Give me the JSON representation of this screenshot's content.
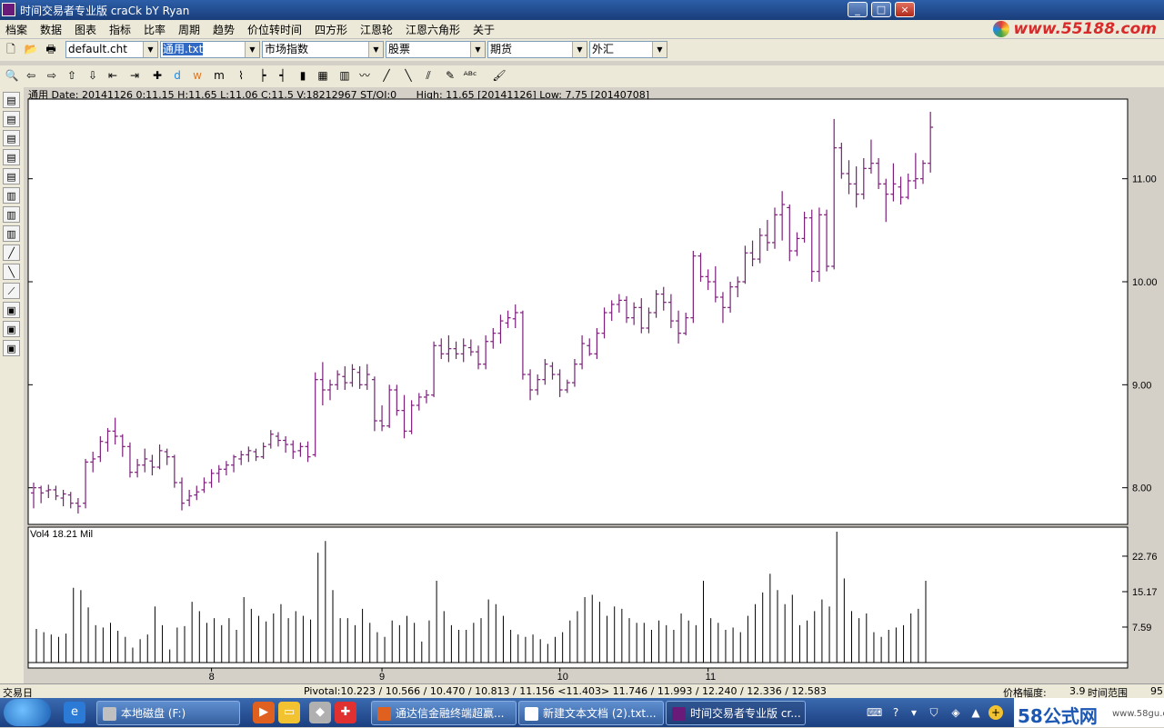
{
  "window": {
    "title": "时间交易者专业版 craCk bY Ryan",
    "buttons": [
      "_",
      "□",
      "×"
    ],
    "logo_text": "www.55188.com"
  },
  "menu": [
    "档案",
    "数据",
    "图表",
    "指标",
    "比率",
    "周期",
    "趋势",
    "价位转时间",
    "四方形",
    "江恩轮",
    "江恩六角形",
    "关于"
  ],
  "toolbar1": {
    "combos": [
      {
        "name": "chart-file",
        "value": "default.cht"
      },
      {
        "name": "data-file",
        "value": "通用.txt"
      },
      {
        "name": "market-index",
        "value": "市场指数"
      },
      {
        "name": "stocks",
        "value": "股票"
      },
      {
        "name": "futures",
        "value": "期货"
      },
      {
        "name": "forex",
        "value": "外汇"
      }
    ]
  },
  "toolbar2": {
    "icons": [
      "zoom-icon",
      "arrow-left-icon",
      "arrow-right-icon",
      "arrow-up-icon",
      "arrow-down-icon",
      "bar-left-icon",
      "bar-right-icon",
      "crosshair-icon",
      "daily-icon",
      "weekly-icon",
      "monthly-icon",
      "line-chart-icon",
      "ohlc-icon",
      "hlc-icon",
      "volume-icon",
      "calendar-icon",
      "bar-chart-icon",
      "swing-icon",
      "trend-icon",
      "line-tool-icon",
      "parallel-icon",
      "gann-fan-icon",
      "abc-icon",
      "brush-icon"
    ],
    "glyphs": [
      "🔍",
      "⇦",
      "⇨",
      "⇧",
      "⇩",
      "⇤",
      "⇥",
      "✚",
      "d",
      "w",
      "m",
      "⌇",
      "┝",
      "┥",
      "▮",
      "▦",
      "▥",
      "〰",
      "╱",
      "╲",
      "⫽",
      "✎",
      "ᴬᴮᶜ",
      "🖌"
    ]
  },
  "left_tools": [
    "▤",
    "▤",
    "▤",
    "▤",
    "▤",
    "▥",
    "▥",
    "▥",
    "╱",
    "╲",
    "⟋",
    "▣",
    "▣",
    "▣"
  ],
  "chart": {
    "info": "通用  Date: 20141126 0:11.15  H:11.65  L:11.06  C:11.5  V:18212967 ST/OI:0",
    "high_low": "High: 11.65 [20141126]  Low: 7.75 [20140708]"
  },
  "chart_data": {
    "type": "ohlc",
    "price_axis_ticks": [
      "11.00",
      "10.00",
      "9.00",
      "8.00"
    ],
    "price_ylim": [
      7.75,
      11.65
    ],
    "x_month_labels": [
      "8",
      "9",
      "10",
      "11"
    ],
    "volume_label": "Vol4  18.21 Mil",
    "volume_ticks": [
      "22.76",
      "15.17",
      "7.59"
    ],
    "volume_ylim": [
      0,
      28
    ],
    "ohlc": [
      [
        7.95,
        8.05,
        7.8,
        8.0
      ],
      [
        8.0,
        8.02,
        7.85,
        7.95
      ],
      [
        7.97,
        8.03,
        7.9,
        7.98
      ],
      [
        7.98,
        8.02,
        7.88,
        7.92
      ],
      [
        7.9,
        7.98,
        7.82,
        7.94
      ],
      [
        7.93,
        7.96,
        7.8,
        7.85
      ],
      [
        7.85,
        7.9,
        7.75,
        7.82
      ],
      [
        7.85,
        8.28,
        7.8,
        8.25
      ],
      [
        8.25,
        8.35,
        8.15,
        8.28
      ],
      [
        8.3,
        8.5,
        8.25,
        8.45
      ],
      [
        8.44,
        8.58,
        8.35,
        8.55
      ],
      [
        8.55,
        8.68,
        8.42,
        8.5
      ],
      [
        8.5,
        8.52,
        8.3,
        8.4
      ],
      [
        8.4,
        8.44,
        8.1,
        8.15
      ],
      [
        8.15,
        8.28,
        8.1,
        8.22
      ],
      [
        8.22,
        8.38,
        8.15,
        8.28
      ],
      [
        8.26,
        8.32,
        8.12,
        8.2
      ],
      [
        8.2,
        8.42,
        8.18,
        8.36
      ],
      [
        8.35,
        8.38,
        8.22,
        8.3
      ],
      [
        8.3,
        8.32,
        8.0,
        8.05
      ],
      [
        8.05,
        8.1,
        7.78,
        7.85
      ],
      [
        7.88,
        7.98,
        7.82,
        7.92
      ],
      [
        7.93,
        8.02,
        7.88,
        7.96
      ],
      [
        7.98,
        8.1,
        7.95,
        8.05
      ],
      [
        8.05,
        8.18,
        8.0,
        8.14
      ],
      [
        8.14,
        8.22,
        8.05,
        8.18
      ],
      [
        8.18,
        8.26,
        8.12,
        8.22
      ],
      [
        8.22,
        8.32,
        8.15,
        8.3
      ],
      [
        8.28,
        8.36,
        8.22,
        8.32
      ],
      [
        8.32,
        8.4,
        8.25,
        8.36
      ],
      [
        8.35,
        8.38,
        8.26,
        8.3
      ],
      [
        8.3,
        8.44,
        8.28,
        8.4
      ],
      [
        8.42,
        8.56,
        8.38,
        8.52
      ],
      [
        8.5,
        8.54,
        8.4,
        8.46
      ],
      [
        8.46,
        8.5,
        8.34,
        8.42
      ],
      [
        8.42,
        8.46,
        8.28,
        8.35
      ],
      [
        8.36,
        8.44,
        8.3,
        8.4
      ],
      [
        8.4,
        8.45,
        8.25,
        8.3
      ],
      [
        8.32,
        9.12,
        8.3,
        9.05
      ],
      [
        9.05,
        9.22,
        8.8,
        8.95
      ],
      [
        8.95,
        9.05,
        8.85,
        9.0
      ],
      [
        9.0,
        9.14,
        8.95,
        9.1
      ],
      [
        9.08,
        9.18,
        8.95,
        9.02
      ],
      [
        9.02,
        9.2,
        8.98,
        9.15
      ],
      [
        9.12,
        9.18,
        8.96,
        9.0
      ],
      [
        9.0,
        9.2,
        8.95,
        9.1
      ],
      [
        9.05,
        9.08,
        8.55,
        8.65
      ],
      [
        8.65,
        8.8,
        8.55,
        8.6
      ],
      [
        8.6,
        9.0,
        8.58,
        8.95
      ],
      [
        8.95,
        9.0,
        8.7,
        8.75
      ],
      [
        8.75,
        8.9,
        8.48,
        8.55
      ],
      [
        8.55,
        8.85,
        8.52,
        8.8
      ],
      [
        8.8,
        8.92,
        8.75,
        8.88
      ],
      [
        8.88,
        8.95,
        8.82,
        8.9
      ],
      [
        8.9,
        9.42,
        8.88,
        9.38
      ],
      [
        9.38,
        9.45,
        9.25,
        9.3
      ],
      [
        9.3,
        9.48,
        9.22,
        9.35
      ],
      [
        9.35,
        9.42,
        9.25,
        9.3
      ],
      [
        9.3,
        9.45,
        9.22,
        9.38
      ],
      [
        9.36,
        9.44,
        9.28,
        9.32
      ],
      [
        9.32,
        9.38,
        9.15,
        9.2
      ],
      [
        9.2,
        9.48,
        9.15,
        9.42
      ],
      [
        9.42,
        9.55,
        9.35,
        9.5
      ],
      [
        9.5,
        9.68,
        9.4,
        9.62
      ],
      [
        9.6,
        9.72,
        9.55,
        9.65
      ],
      [
        9.64,
        9.78,
        9.55,
        9.7
      ],
      [
        9.7,
        9.72,
        9.05,
        9.1
      ],
      [
        9.1,
        9.15,
        8.85,
        8.95
      ],
      [
        8.95,
        9.1,
        8.9,
        9.05
      ],
      [
        9.05,
        9.25,
        9.0,
        9.2
      ],
      [
        9.18,
        9.22,
        9.05,
        9.1
      ],
      [
        9.1,
        9.15,
        8.88,
        8.95
      ],
      [
        8.95,
        9.05,
        8.92,
        9.02
      ],
      [
        9.02,
        9.25,
        8.98,
        9.2
      ],
      [
        9.2,
        9.48,
        9.15,
        9.4
      ],
      [
        9.38,
        9.45,
        9.28,
        9.3
      ],
      [
        9.3,
        9.55,
        9.25,
        9.5
      ],
      [
        9.5,
        9.75,
        9.45,
        9.7
      ],
      [
        9.7,
        9.82,
        9.62,
        9.78
      ],
      [
        9.78,
        9.88,
        9.7,
        9.82
      ],
      [
        9.82,
        9.86,
        9.6,
        9.65
      ],
      [
        9.65,
        9.8,
        9.58,
        9.75
      ],
      [
        9.75,
        9.84,
        9.5,
        9.55
      ],
      [
        9.55,
        9.75,
        9.5,
        9.7
      ],
      [
        9.7,
        9.92,
        9.65,
        9.88
      ],
      [
        9.88,
        9.95,
        9.72,
        9.8
      ],
      [
        9.8,
        9.88,
        9.55,
        9.62
      ],
      [
        9.62,
        9.72,
        9.4,
        9.5
      ],
      [
        9.5,
        9.7,
        9.48,
        9.65
      ],
      [
        9.65,
        10.3,
        9.6,
        10.25
      ],
      [
        10.25,
        10.28,
        10.0,
        10.05
      ],
      [
        10.05,
        10.12,
        9.92,
        10.0
      ],
      [
        10.0,
        10.15,
        9.8,
        9.85
      ],
      [
        9.85,
        9.9,
        9.6,
        9.75
      ],
      [
        9.75,
        10.0,
        9.7,
        9.95
      ],
      [
        9.95,
        10.05,
        9.85,
        10.0
      ],
      [
        10.0,
        10.35,
        9.98,
        10.28
      ],
      [
        10.28,
        10.4,
        10.15,
        10.22
      ],
      [
        10.22,
        10.52,
        10.18,
        10.45
      ],
      [
        10.45,
        10.6,
        10.3,
        10.38
      ],
      [
        10.38,
        10.72,
        10.32,
        10.65
      ],
      [
        10.65,
        10.88,
        10.4,
        10.75
      ],
      [
        10.72,
        10.75,
        10.2,
        10.3
      ],
      [
        10.3,
        10.48,
        10.25,
        10.42
      ],
      [
        10.42,
        10.68,
        10.38,
        10.62
      ],
      [
        10.62,
        10.7,
        10.0,
        10.1
      ],
      [
        10.1,
        10.72,
        10.0,
        10.65
      ],
      [
        10.65,
        10.7,
        10.1,
        10.15
      ],
      [
        10.15,
        11.58,
        10.12,
        11.3
      ],
      [
        11.3,
        11.35,
        11.0,
        11.05
      ],
      [
        11.05,
        11.18,
        10.85,
        10.95
      ],
      [
        10.95,
        11.12,
        10.72,
        10.85
      ],
      [
        10.85,
        11.2,
        10.8,
        11.1
      ],
      [
        11.1,
        11.38,
        11.05,
        11.15
      ],
      [
        11.15,
        11.2,
        10.9,
        10.95
      ],
      [
        10.95,
        11.0,
        10.58,
        10.85
      ],
      [
        10.85,
        11.15,
        10.78,
        10.95
      ],
      [
        10.92,
        11.02,
        10.75,
        10.82
      ],
      [
        10.82,
        11.05,
        10.8,
        10.98
      ],
      [
        10.98,
        11.25,
        10.9,
        11.0
      ],
      [
        11.0,
        11.18,
        10.95,
        11.15
      ],
      [
        11.15,
        11.65,
        11.06,
        11.5
      ]
    ],
    "volume": [
      7.2,
      6.5,
      6.0,
      5.5,
      6.2,
      16.0,
      15.5,
      11.8,
      8.0,
      7.5,
      8.5,
      6.8,
      5.5,
      3.2,
      5.0,
      6.0,
      12.0,
      8.0,
      2.8,
      7.5,
      7.8,
      13.0,
      11.0,
      8.5,
      9.5,
      8.0,
      9.5,
      7.0,
      14.0,
      11.5,
      10.0,
      8.8,
      10.5,
      12.5,
      9.5,
      11.0,
      10.0,
      9.2,
      23.5,
      26.0,
      15.5,
      9.5,
      9.5,
      8.0,
      11.5,
      8.5,
      6.5,
      5.5,
      9.0,
      8.0,
      10.0,
      8.5,
      4.5,
      9.0,
      17.5,
      11.0,
      8.0,
      7.0,
      7.0,
      8.5,
      9.5,
      13.5,
      12.5,
      10.0,
      7.0,
      6.0,
      5.5,
      6.0,
      5.0,
      4.0,
      5.5,
      6.5,
      9.0,
      11.0,
      14.0,
      14.5,
      13.0,
      10.0,
      12.0,
      11.5,
      9.5,
      8.5,
      8.5,
      7.0,
      9.0,
      8.0,
      7.0,
      10.5,
      9.0,
      8.0,
      17.5,
      9.5,
      8.5,
      7.0,
      7.5,
      6.5,
      10.0,
      12.5,
      15.0,
      19.0,
      15.5,
      12.5,
      14.5,
      8.0,
      9.0,
      11.0,
      13.5,
      12.0,
      28.0,
      18.0,
      11.0,
      9.5,
      10.5,
      6.5,
      5.5,
      7.0,
      7.5,
      8.0,
      10.5,
      11.5,
      17.5
    ]
  },
  "status": {
    "left": "交易日",
    "pivotal": "Pivotal:10.223 / 10.566 / 10.470 / 10.813 / 11.156 <11.403> 11.746 / 11.993 / 12.240 / 12.336 / 12.583",
    "price_range_label": "价格幅度:",
    "price_range_value": "3.9",
    "time_range_label": "时间范围",
    "time_range_value": "95"
  },
  "taskbar": {
    "items": [
      {
        "label": "本地磁盘 (F:)",
        "color": "#c0c0c0"
      },
      {
        "label": "通达信金融终端超赢...",
        "color": "#e06020"
      },
      {
        "label": "新建文本文档 (2).txt...",
        "color": "#ffffff"
      },
      {
        "label": "时间交易者专业版 cr...",
        "color": "#6a1b7a"
      }
    ],
    "brand": "58公式网",
    "brand_url": "www.58gu.com"
  }
}
